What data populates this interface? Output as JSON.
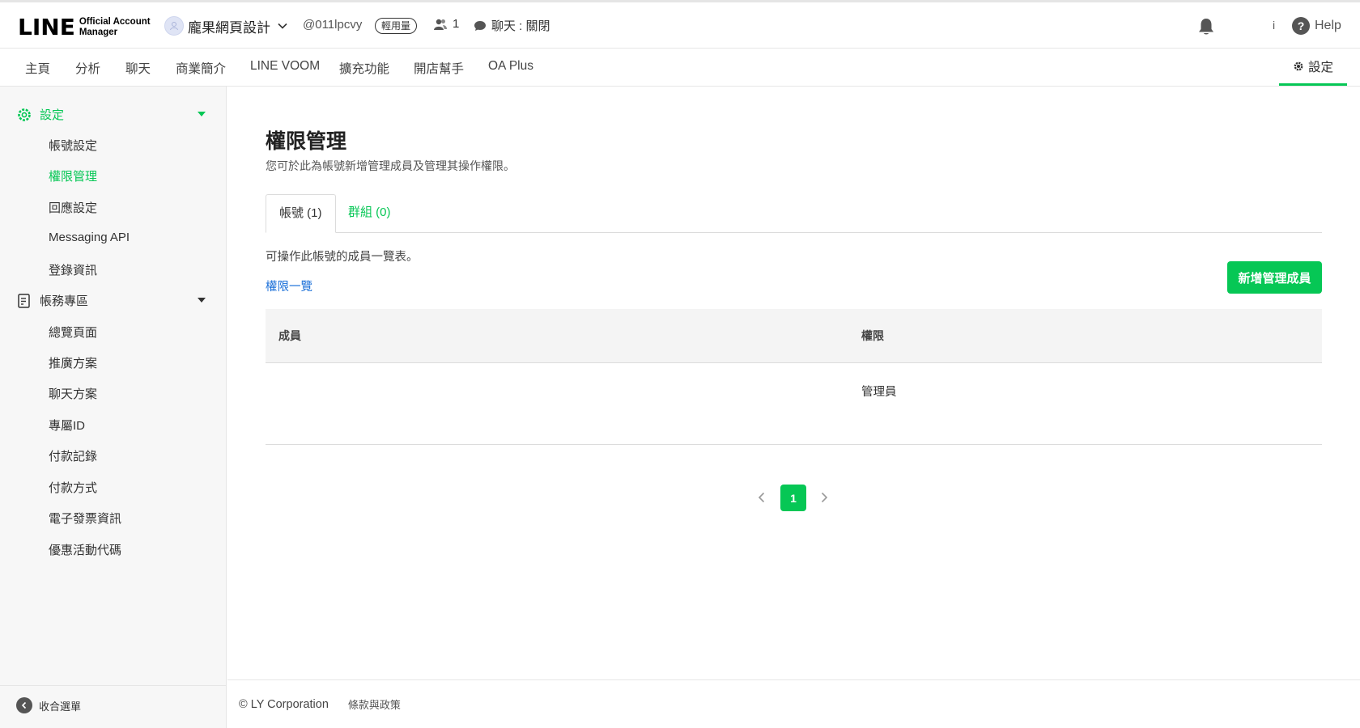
{
  "header": {
    "logo_main": "LINE",
    "logo_sub_1": "Official Account",
    "logo_sub_2": "Manager",
    "account_name": "龐果網頁設計",
    "account_id": "@011lpcvy",
    "usage_badge": "輕用量",
    "friend_count": "1",
    "chat_status": "聊天 : 關閉",
    "info_label": "i",
    "help_label": "Help"
  },
  "nav": {
    "items": [
      "主頁",
      "分析",
      "聊天",
      "商業簡介",
      "LINE VOOM",
      "擴充功能",
      "開店幫手",
      "OA Plus"
    ],
    "settings": "設定"
  },
  "sidebar": {
    "settings_title": "設定",
    "settings_items": [
      "帳號設定",
      "權限管理",
      "回應設定",
      "Messaging API",
      "登錄資訊"
    ],
    "billing_title": "帳務專區",
    "billing_items": [
      "總覽頁面",
      "推廣方案",
      "聊天方案",
      "專屬ID",
      "付款記錄",
      "付款方式",
      "電子發票資訊",
      "優惠活動代碼"
    ],
    "collapse_label": "收合選單"
  },
  "main": {
    "title": "權限管理",
    "description": "您可於此為帳號新增管理成員及管理其操作權限。",
    "tabs": [
      "帳號 (1)",
      "群組 (0)"
    ],
    "list_description": "可操作此帳號的成員一覽表。",
    "permission_link": "權限一覽",
    "add_button": "新增管理成員",
    "table": {
      "headers": [
        "成員",
        "權限"
      ],
      "rows": [
        [
          "",
          "管理員"
        ]
      ]
    },
    "pagination": {
      "current": "1"
    }
  },
  "footer": {
    "copyright": "© LY Corporation",
    "policy": "條款與政策"
  },
  "colors": {
    "accent": "#06c755",
    "link": "#1a6fd8"
  }
}
